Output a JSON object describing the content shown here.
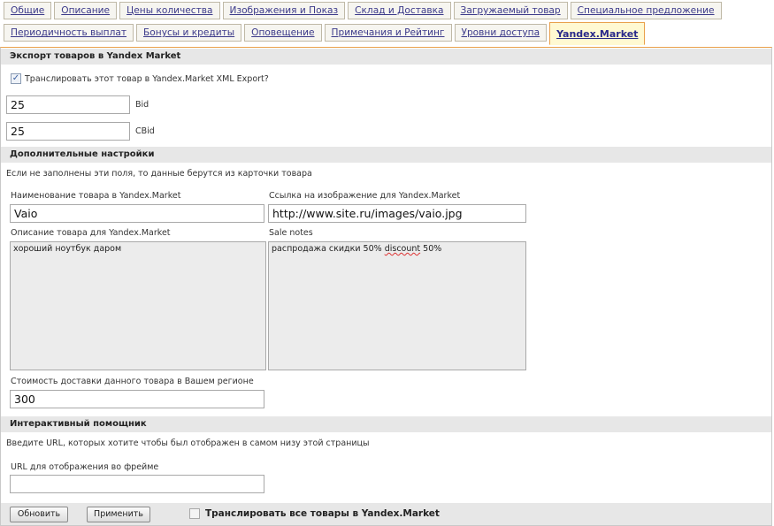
{
  "tabs_row1": [
    "Общие",
    "Описание",
    "Цены количества",
    "Изображения и Показ",
    "Склад и Доставка",
    "Загружаемый товар",
    "Специальное предложение"
  ],
  "tabs_row2": [
    "Периодичность выплат",
    "Бонусы и кредиты",
    "Оповещение",
    "Примечания и Рейтинг",
    "Уровни доступа",
    "Yandex.Market"
  ],
  "active_tab": "Yandex.Market",
  "export": {
    "header": "Экспорт товаров в Yandex Market",
    "checkbox_label": "Транслировать этот товар в Yandex.Market XML Export?",
    "checked": true,
    "bid_value": "25",
    "bid_label": "Bid",
    "cbid_value": "25",
    "cbid_label": "CBid"
  },
  "additional": {
    "header": "Дополнительные настройки",
    "note": "Если не заполнены эти поля, то данные берутся из карточки товара",
    "name_label": "Наименование товара в Yandex.Market",
    "name_value": "Vaio",
    "image_label": "Ссылка на изображение для Yandex.Market",
    "image_value": "http://www.site.ru/images/vaio.jpg",
    "desc_label": "Описание товара для Yandex.Market",
    "desc_value": "хороший ноутбук  даром",
    "sale_label": "Sale notes",
    "sale_value_prefix": "распродажа  скидки  50%  ",
    "sale_value_misspelled": "discount",
    "sale_value_suffix": " 50%",
    "delivery_label": "Стоимость доставки данного товара в Вашем регионе",
    "delivery_value": "300"
  },
  "assistant": {
    "header": "Интерактивный помощник",
    "note": "Введите URL, которых хотите чтобы был отображен в самом низу этой страницы",
    "url_label": "URL для отображения во фрейме",
    "url_value": ""
  },
  "footer": {
    "update_button": "Обновить",
    "apply_button": "Применить",
    "export_all_label": "Транслировать все товары в Yandex.Market",
    "export_all_checked": false
  }
}
